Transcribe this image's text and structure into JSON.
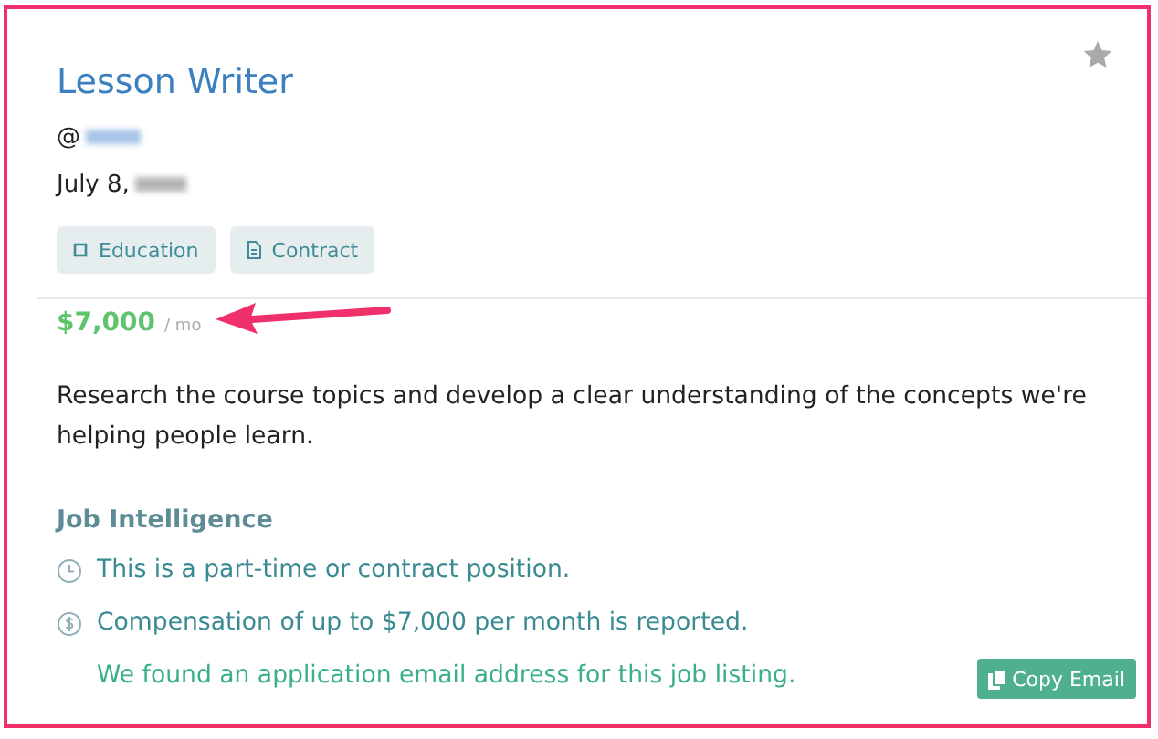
{
  "job": {
    "title": "Lesson Writer",
    "handle_prefix": "@",
    "date_prefix": "July 8,",
    "starred": false,
    "tags": [
      {
        "label": "Education",
        "kind": "square"
      },
      {
        "label": "Contract",
        "kind": "document"
      }
    ],
    "salary": {
      "amount": "$7,000",
      "period": "/ mo"
    },
    "description": "Research the course topics and develop a clear understanding of the concepts we're helping people learn."
  },
  "intelligence": {
    "heading": "Job Intelligence",
    "items": [
      {
        "kind": "clock",
        "text": "This is a part-time or contract position."
      },
      {
        "kind": "dollar",
        "text": "Compensation of up to $7,000 per month is reported."
      },
      {
        "kind": "email",
        "text": "We found an application email address for this job listing.",
        "button": "Copy Email"
      }
    ]
  }
}
